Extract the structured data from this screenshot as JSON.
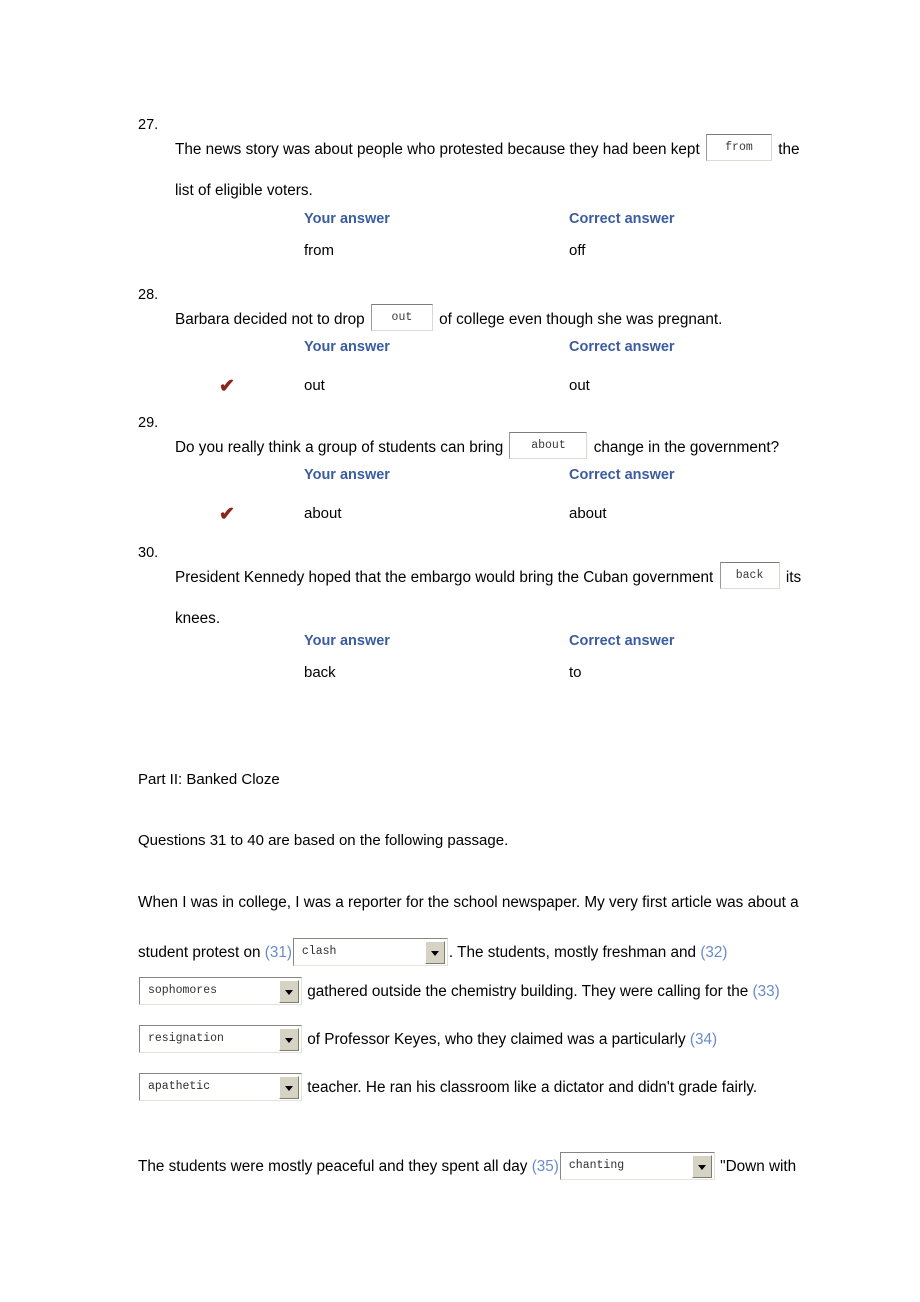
{
  "questions": [
    {
      "number": "27.",
      "sentence_before": "The news story was about people who protested because they had been kept",
      "blank_value": "from",
      "sentence_after": "the",
      "sentence_line2": "list of eligible voters.",
      "your_answer_label": "Your answer",
      "correct_answer_label": "Correct answer",
      "your_answer": "from",
      "correct_answer": "off",
      "is_correct": false,
      "check_mark": "✔"
    },
    {
      "number": "28.",
      "sentence_before": "Barbara decided not to drop",
      "blank_value": "out",
      "sentence_after": "of college even though she was pregnant.",
      "sentence_line2": "",
      "your_answer_label": "Your answer",
      "correct_answer_label": "Correct answer",
      "your_answer": "out",
      "correct_answer": "out",
      "is_correct": true,
      "check_mark": "✔"
    },
    {
      "number": "29.",
      "sentence_before": "Do you really think a group of students can bring",
      "blank_value": "about",
      "sentence_after": "change in the government?",
      "sentence_line2": "",
      "your_answer_label": "Your answer",
      "correct_answer_label": "Correct answer",
      "your_answer": "about",
      "correct_answer": "about",
      "is_correct": true,
      "check_mark": "✔"
    },
    {
      "number": "30.",
      "sentence_before": "President Kennedy hoped that the embargo would bring the Cuban government",
      "blank_value": "back",
      "sentence_after": "its",
      "sentence_line2": "knees.",
      "your_answer_label": "Your answer",
      "correct_answer_label": "Correct answer",
      "your_answer": "back",
      "correct_answer": "to",
      "is_correct": false,
      "check_mark": "✔"
    }
  ],
  "part2": {
    "heading": "Part II: Banked Cloze",
    "instruction": "Questions 31 to 40 are based on the following passage.",
    "passage": {
      "line1": "When I was in college, I was a reporter for the school newspaper. My very first article was about a",
      "line2_before": "student protest on ",
      "ref31": "(31)",
      "select31": "clash",
      "line2_after": ". The students, mostly freshman and ",
      "ref32": "(32)",
      "select32": "sophomores",
      "line3_after": "gathered outside the chemistry building. They were calling for the ",
      "ref33": "(33)",
      "select33": "resignation",
      "line4_after": "of Professor Keyes, who they claimed was a particularly ",
      "ref34": "(34)",
      "select34": "apathetic",
      "line5_after": "teacher. He ran his classroom like a dictator and didn't grade fairly.",
      "line6_before": "The students were mostly peaceful and they spent all day ",
      "ref35": "(35)",
      "select35": "chanting",
      "line6_after": "\"Down with"
    }
  },
  "colors": {
    "answer_heading_blue": "#3b5ca0",
    "reference_blue": "#6a8bc9",
    "check_red": "#8c2418",
    "text_black": "#000000"
  }
}
